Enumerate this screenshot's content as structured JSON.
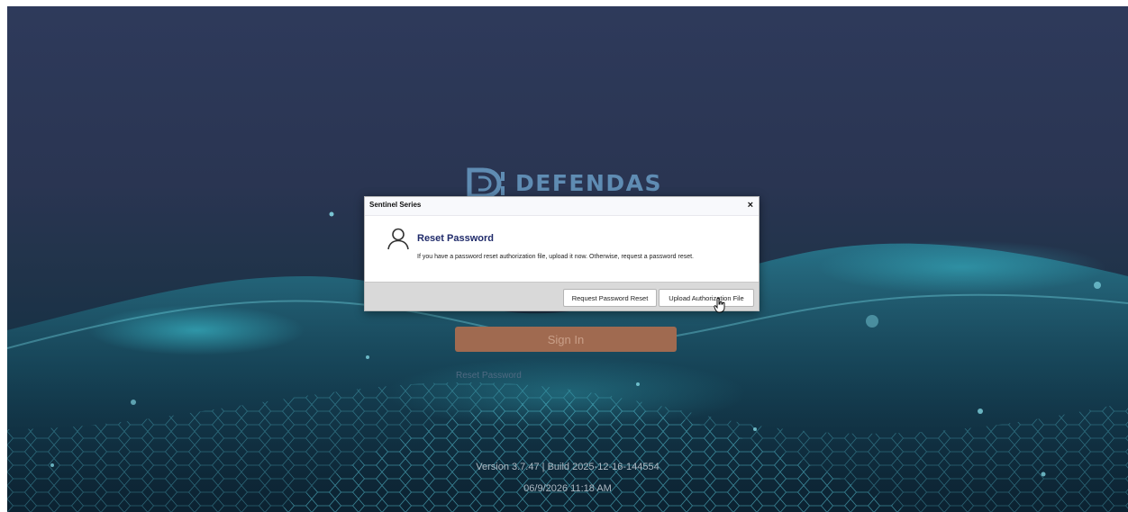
{
  "brand": {
    "name": "DEFENDAS",
    "logo_icon": "defendas-logo"
  },
  "login": {
    "signin_label": "Sign In",
    "reset_link": "Reset Password"
  },
  "footer": {
    "version": "Version 3.7.47 | Build 2025-12-16-144554",
    "datetime": "06/9/2026 11:18 AM"
  },
  "dialog": {
    "title": "Sentinel Series",
    "close_symbol": "×",
    "heading": "Reset Password",
    "message": "If you have a password reset authorization file, upload it now. Otherwise, request a password reset.",
    "user_icon": "user-icon",
    "buttons": {
      "request": "Request Password Reset",
      "upload": "Upload Authorization File"
    }
  },
  "colors": {
    "background_top": "#2e3a5b",
    "background_bottom": "#0c2231",
    "brand": "#5f8cb3",
    "signin_button": "#a06a50",
    "dialog_heading": "#1f2a6a"
  }
}
